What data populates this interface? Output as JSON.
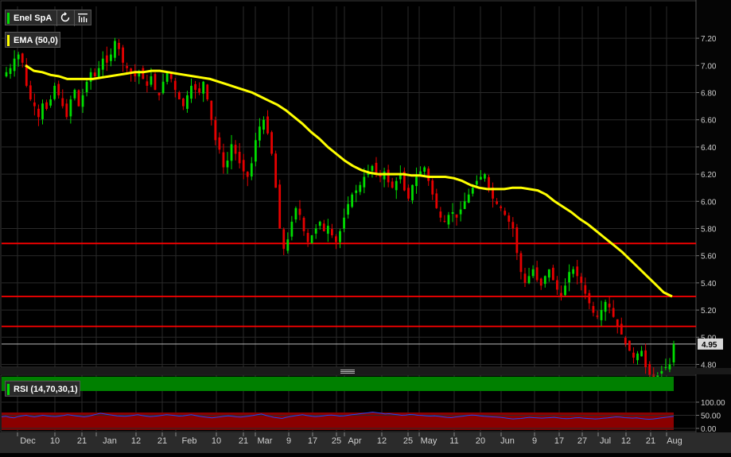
{
  "symbol": "Enel SpA",
  "price_indicator": {
    "label": "EMA (50,0)",
    "color": "#ffff00"
  },
  "rsi_indicator": {
    "label": "RSI (14,70,30,1)"
  },
  "last_price_label": "4.95",
  "icons": [
    "refresh-icon",
    "bar-chart-settings-icon"
  ],
  "colors": {
    "up": "#00dd00",
    "down": "#e60000",
    "neutral": "#aaaaaa",
    "ema": "#ffff00",
    "resistance": "#ff0000",
    "rsi_line": "#2244ee",
    "overbought_zone": "#008000",
    "oversold_zone": "#8b0000"
  },
  "chart_data": [
    {
      "type": "candlestick",
      "x_tick_labels": [
        "Dec",
        "10",
        "21",
        "Jan",
        "12",
        "21",
        "Feb",
        "10",
        "21",
        "Mar",
        "9",
        "17",
        "25",
        "Apr",
        "12",
        "25",
        "May",
        "11",
        "20",
        "Jun",
        "9",
        "17",
        "27",
        "Jul",
        "12",
        "21",
        "Aug"
      ],
      "y_tick_labels": [
        "7.20",
        "7.00",
        "6.80",
        "6.60",
        "6.40",
        "6.20",
        "6.00",
        "5.80",
        "5.60",
        "5.40",
        "5.20",
        "5.00",
        "4.80"
      ],
      "ylim": [
        4.6,
        7.3
      ],
      "horizontal_lines": [
        5.69,
        5.3,
        5.08
      ],
      "last_price": 4.95,
      "ema_period": 50,
      "closes": [
        6.95,
        6.98,
        7.05,
        7.08,
        7.02,
        6.85,
        6.75,
        6.7,
        6.62,
        6.72,
        6.68,
        6.75,
        6.85,
        6.78,
        6.7,
        6.62,
        6.75,
        6.82,
        6.7,
        6.78,
        6.88,
        6.95,
        6.92,
        6.98,
        7.05,
        7.02,
        7.08,
        7.18,
        7.12,
        7.02,
        6.98,
        6.95,
        6.92,
        6.96,
        6.9,
        6.85,
        6.92,
        6.82,
        6.78,
        6.88,
        6.95,
        6.9,
        6.82,
        6.75,
        6.7,
        6.78,
        6.85,
        6.82,
        6.8,
        6.88,
        6.75,
        6.6,
        6.45,
        6.38,
        6.25,
        6.3,
        6.42,
        6.35,
        6.28,
        6.22,
        6.18,
        6.28,
        6.45,
        6.55,
        6.6,
        6.5,
        6.35,
        6.1,
        5.8,
        5.65,
        5.72,
        5.85,
        5.95,
        5.9,
        5.78,
        5.7,
        5.75,
        5.8,
        5.85,
        5.78,
        5.82,
        5.75,
        5.7,
        5.78,
        5.88,
        5.98,
        6.05,
        6.08,
        6.12,
        6.18,
        6.22,
        6.26,
        6.2,
        6.18,
        6.22,
        6.14,
        6.1,
        6.15,
        6.2,
        6.08,
        6.02,
        6.12,
        6.18,
        6.22,
        6.25,
        6.15,
        6.05,
        5.95,
        5.88,
        5.85,
        5.9,
        5.92,
        5.88,
        5.94,
        6.0,
        6.05,
        6.1,
        6.15,
        6.18,
        6.2,
        6.1,
        6.02,
        5.98,
        5.95,
        5.9,
        5.85,
        5.8,
        5.62,
        5.48,
        5.4,
        5.45,
        5.5,
        5.42,
        5.38,
        5.45,
        5.5,
        5.42,
        5.35,
        5.3,
        5.38,
        5.48,
        5.5,
        5.45,
        5.4,
        5.32,
        5.25,
        5.18,
        5.15,
        5.2,
        5.26,
        5.22,
        5.15,
        5.08,
        5.02,
        4.95,
        4.9,
        4.85,
        4.88,
        4.9,
        4.78,
        4.72,
        4.7,
        4.72,
        4.75,
        4.78,
        4.8,
        4.95
      ],
      "ema_values": [
        7.0,
        6.96,
        6.95,
        6.93,
        6.92,
        6.9,
        6.9,
        6.9,
        6.9,
        6.91,
        6.92,
        6.93,
        6.94,
        6.95,
        6.95,
        6.96,
        6.96,
        6.95,
        6.94,
        6.93,
        6.92,
        6.91,
        6.9,
        6.88,
        6.86,
        6.84,
        6.82,
        6.8,
        6.77,
        6.74,
        6.71,
        6.67,
        6.62,
        6.57,
        6.51,
        6.46,
        6.4,
        6.35,
        6.3,
        6.26,
        6.23,
        6.21,
        6.2,
        6.2,
        6.2,
        6.2,
        6.19,
        6.19,
        6.18,
        6.18,
        6.18,
        6.17,
        6.15,
        6.12,
        6.1,
        6.09,
        6.09,
        6.09,
        6.1,
        6.1,
        6.09,
        6.08,
        6.05,
        6.0,
        5.96,
        5.92,
        5.87,
        5.83,
        5.78,
        5.73,
        5.68,
        5.63,
        5.57,
        5.51,
        5.45,
        5.39,
        5.33,
        5.3
      ]
    },
    {
      "type": "line",
      "series": [
        {
          "name": "RSI (14,70,30,1)"
        }
      ],
      "y_tick_labels": [
        "100.00",
        "50.00",
        "0.00"
      ],
      "ylim": [
        0,
        100
      ],
      "overbought": 70,
      "oversold": 30,
      "values": [
        44,
        46,
        42,
        40,
        45,
        48,
        50,
        46,
        44,
        47,
        50,
        48,
        46,
        45,
        47,
        49,
        52,
        50,
        48,
        46,
        44,
        46,
        50,
        54,
        58,
        55,
        52,
        50,
        48,
        47,
        46,
        48,
        50,
        52,
        49,
        47,
        45,
        46,
        48,
        50,
        52,
        51,
        49,
        47,
        48,
        50,
        52,
        49,
        46,
        44,
        42,
        40,
        42,
        44,
        46,
        48,
        46,
        44,
        43,
        45,
        47,
        49,
        52,
        55,
        50,
        46,
        42,
        40,
        38,
        42,
        45,
        48,
        50,
        52,
        49,
        47,
        45,
        46,
        48,
        50,
        51,
        49,
        47,
        48,
        50,
        52,
        54,
        56,
        58,
        60,
        62,
        60,
        58,
        55,
        56,
        54,
        52,
        50,
        51,
        53,
        52,
        50,
        49,
        48,
        47,
        48,
        46,
        44,
        42,
        41,
        43,
        45,
        47,
        49,
        51,
        50,
        48,
        46,
        45,
        44,
        43,
        42,
        40,
        38,
        36,
        37,
        38,
        40,
        42,
        41,
        40,
        39,
        40,
        41,
        42,
        40,
        38,
        37,
        38,
        40,
        41,
        39,
        38,
        37,
        36,
        37,
        39,
        40,
        42,
        44,
        43,
        41,
        40,
        39,
        40,
        38,
        36,
        35,
        36,
        38,
        40,
        42,
        44,
        46
      ]
    }
  ]
}
